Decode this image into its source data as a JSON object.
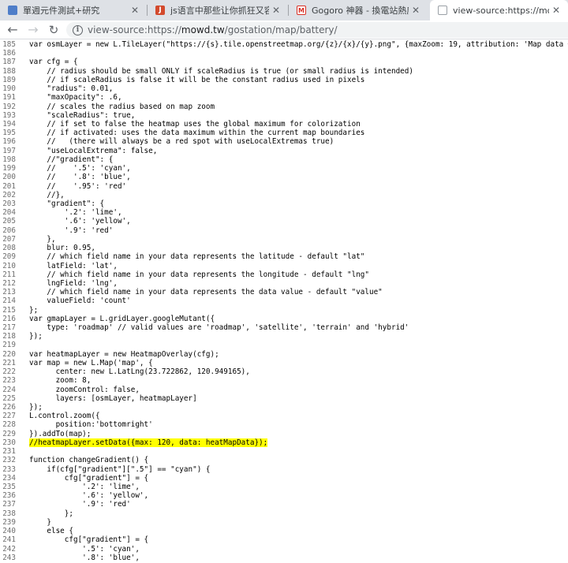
{
  "tabs": [
    {
      "title": "單週元件測試+研究",
      "favicon": "document-icon",
      "color": "#4f7ec9",
      "active": false
    },
    {
      "title": "js语言中那些让你抓狂又容易混淆",
      "favicon": "js-icon",
      "color": "#d34a2d",
      "active": false
    },
    {
      "title": "Gogoro 神器 - 換電站熱度圖",
      "favicon": "gmail-icon",
      "color": "#d93025",
      "active": false
    },
    {
      "title": "view-source:https://mowd.tw/g",
      "favicon": "document-icon",
      "color": "#9aa0a6",
      "active": true
    }
  ],
  "toolbar": {
    "back_icon": "arrow-left-icon",
    "forward_icon": "arrow-right-icon",
    "reload_icon": "reload-icon",
    "url_prefix": "view-source:",
    "url_scheme": "https://",
    "url_host": "mowd.tw",
    "url_path": "/gostation/map/battery/"
  },
  "source": {
    "highlight_line": 230,
    "highlight_color": "#ffff00",
    "lines": [
      {
        "n": "185",
        "t": "var osmLayer = new L.TileLayer(\"https://{s}.tile.openstreetmap.org/{z}/{x}/{y}.png\", {maxZoom: 19, attribution: 'Map data ©"
      },
      {
        "n": "186",
        "t": ""
      },
      {
        "n": "187",
        "t": "var cfg = {"
      },
      {
        "n": "188",
        "t": "    // radius should be small ONLY if scaleRadius is true (or small radius is intended)"
      },
      {
        "n": "189",
        "t": "    // if scaleRadius is false it will be the constant radius used in pixels"
      },
      {
        "n": "190",
        "t": "    \"radius\": 0.01,"
      },
      {
        "n": "191",
        "t": "    \"maxOpacity\": .6,"
      },
      {
        "n": "192",
        "t": "    // scales the radius based on map zoom"
      },
      {
        "n": "193",
        "t": "    \"scaleRadius\": true,"
      },
      {
        "n": "194",
        "t": "    // if set to false the heatmap uses the global maximum for colorization"
      },
      {
        "n": "195",
        "t": "    // if activated: uses the data maximum within the current map boundaries"
      },
      {
        "n": "196",
        "t": "    //   (there will always be a red spot with useLocalExtremas true)"
      },
      {
        "n": "197",
        "t": "    \"useLocalExtrema\": false,"
      },
      {
        "n": "198",
        "t": "    //\"gradient\": {"
      },
      {
        "n": "199",
        "t": "    //    '.5': 'cyan',"
      },
      {
        "n": "200",
        "t": "    //    '.8': 'blue',"
      },
      {
        "n": "201",
        "t": "    //    '.95': 'red'"
      },
      {
        "n": "202",
        "t": "    //},"
      },
      {
        "n": "203",
        "t": "    \"gradient\": {"
      },
      {
        "n": "204",
        "t": "        '.2': 'lime',"
      },
      {
        "n": "205",
        "t": "        '.6': 'yellow',"
      },
      {
        "n": "206",
        "t": "        '.9': 'red'"
      },
      {
        "n": "207",
        "t": "    },"
      },
      {
        "n": "208",
        "t": "    blur: 0.95,"
      },
      {
        "n": "209",
        "t": "    // which field name in your data represents the latitude - default \"lat\""
      },
      {
        "n": "210",
        "t": "    latField: 'lat',"
      },
      {
        "n": "211",
        "t": "    // which field name in your data represents the longitude - default \"lng\""
      },
      {
        "n": "212",
        "t": "    lngField: 'lng',"
      },
      {
        "n": "213",
        "t": "    // which field name in your data represents the data value - default \"value\""
      },
      {
        "n": "214",
        "t": "    valueField: 'count'"
      },
      {
        "n": "215",
        "t": "};"
      },
      {
        "n": "216",
        "t": "var gmapLayer = L.gridLayer.googleMutant({"
      },
      {
        "n": "217",
        "t": "    type: 'roadmap' // valid values are 'roadmap', 'satellite', 'terrain' and 'hybrid'"
      },
      {
        "n": "218",
        "t": "});"
      },
      {
        "n": "219",
        "t": ""
      },
      {
        "n": "220",
        "t": "var heatmapLayer = new HeatmapOverlay(cfg);"
      },
      {
        "n": "221",
        "t": "var map = new L.Map('map', {"
      },
      {
        "n": "222",
        "t": "      center: new L.LatLng(23.722862, 120.949165),"
      },
      {
        "n": "223",
        "t": "      zoom: 8,"
      },
      {
        "n": "224",
        "t": "      zoomControl: false,"
      },
      {
        "n": "225",
        "t": "      layers: [osmLayer, heatmapLayer]"
      },
      {
        "n": "226",
        "t": "});"
      },
      {
        "n": "227",
        "t": "L.control.zoom({"
      },
      {
        "n": "228",
        "t": "      position:'bottomright'"
      },
      {
        "n": "229",
        "t": "}).addTo(map);"
      },
      {
        "n": "230",
        "t": "//heatmapLayer.setData({max: 120, data: heatMapData});"
      },
      {
        "n": "231",
        "t": ""
      },
      {
        "n": "232",
        "t": "function changeGradient() {"
      },
      {
        "n": "233",
        "t": "    if(cfg[\"gradient\"][\".5\"] == \"cyan\") {"
      },
      {
        "n": "234",
        "t": "        cfg[\"gradient\"] = {"
      },
      {
        "n": "235",
        "t": "            '.2': 'lime',"
      },
      {
        "n": "236",
        "t": "            '.6': 'yellow',"
      },
      {
        "n": "237",
        "t": "            '.9': 'red'"
      },
      {
        "n": "238",
        "t": "        };"
      },
      {
        "n": "239",
        "t": "    }"
      },
      {
        "n": "240",
        "t": "    else {"
      },
      {
        "n": "241",
        "t": "        cfg[\"gradient\"] = {"
      },
      {
        "n": "242",
        "t": "            '.5': 'cyan',"
      },
      {
        "n": "243",
        "t": "            '.8': 'blue',"
      }
    ]
  }
}
